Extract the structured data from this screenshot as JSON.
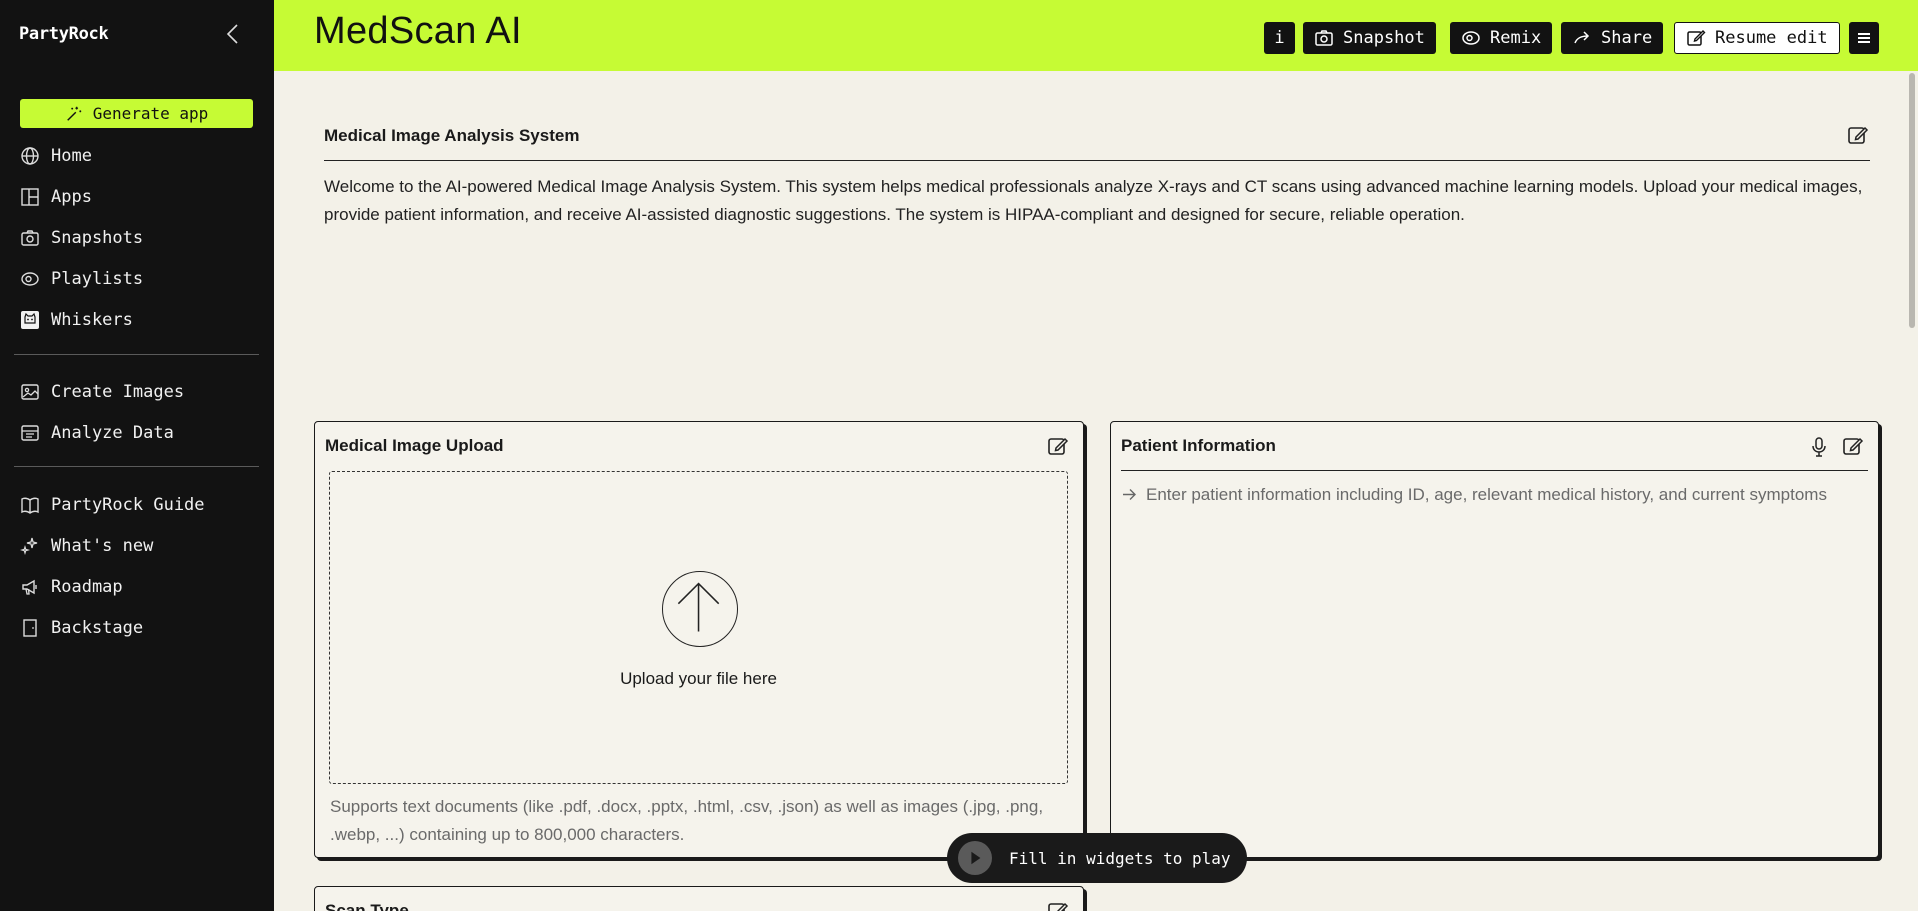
{
  "sidebar": {
    "brand": "PartyRock",
    "generate_label": "Generate app",
    "items_top": [
      {
        "label": "Home",
        "icon": "globe-icon"
      },
      {
        "label": "Apps",
        "icon": "layout-icon"
      },
      {
        "label": "Snapshots",
        "icon": "camera-icon"
      },
      {
        "label": "Playlists",
        "icon": "playlist-icon"
      },
      {
        "label": "Whiskers",
        "icon": "cat-icon"
      }
    ],
    "items_mid": [
      {
        "label": "Create Images",
        "icon": "image-icon"
      },
      {
        "label": "Analyze Data",
        "icon": "data-icon"
      }
    ],
    "items_bottom": [
      {
        "label": "PartyRock Guide",
        "icon": "book-icon"
      },
      {
        "label": "What's new",
        "icon": "sparkle-icon"
      },
      {
        "label": "Roadmap",
        "icon": "megaphone-icon"
      },
      {
        "label": "Backstage",
        "icon": "door-icon"
      }
    ]
  },
  "header": {
    "title": "MedScan AI",
    "info_label": "i",
    "snapshot_label": "Snapshot",
    "remix_label": "Remix",
    "share_label": "Share",
    "resume_label": "Resume edit",
    "accent": "#c6fb34"
  },
  "intro": {
    "title": "Medical Image Analysis System",
    "body": "Welcome to the AI-powered Medical Image Analysis System. This system helps medical professionals analyze X-rays and CT scans using advanced machine learning models. Upload your medical images, provide patient information, and receive AI-assisted diagnostic suggestions. The system is HIPAA-compliant and designed for secure, reliable operation."
  },
  "upload": {
    "title": "Medical Image Upload",
    "drop_text": "Upload your file here",
    "supports": "Supports text documents (like .pdf, .docx, .pptx, .html, .csv, .json) as well as images (.jpg, .png, .webp, ...) containing up to 800,000 characters."
  },
  "patient": {
    "title": "Patient Information",
    "placeholder": "Enter patient information including ID, age, relevant medical history, and current symptoms"
  },
  "next_card": {
    "title": "Scan Type"
  },
  "play": {
    "label": "Fill in widgets to play"
  }
}
